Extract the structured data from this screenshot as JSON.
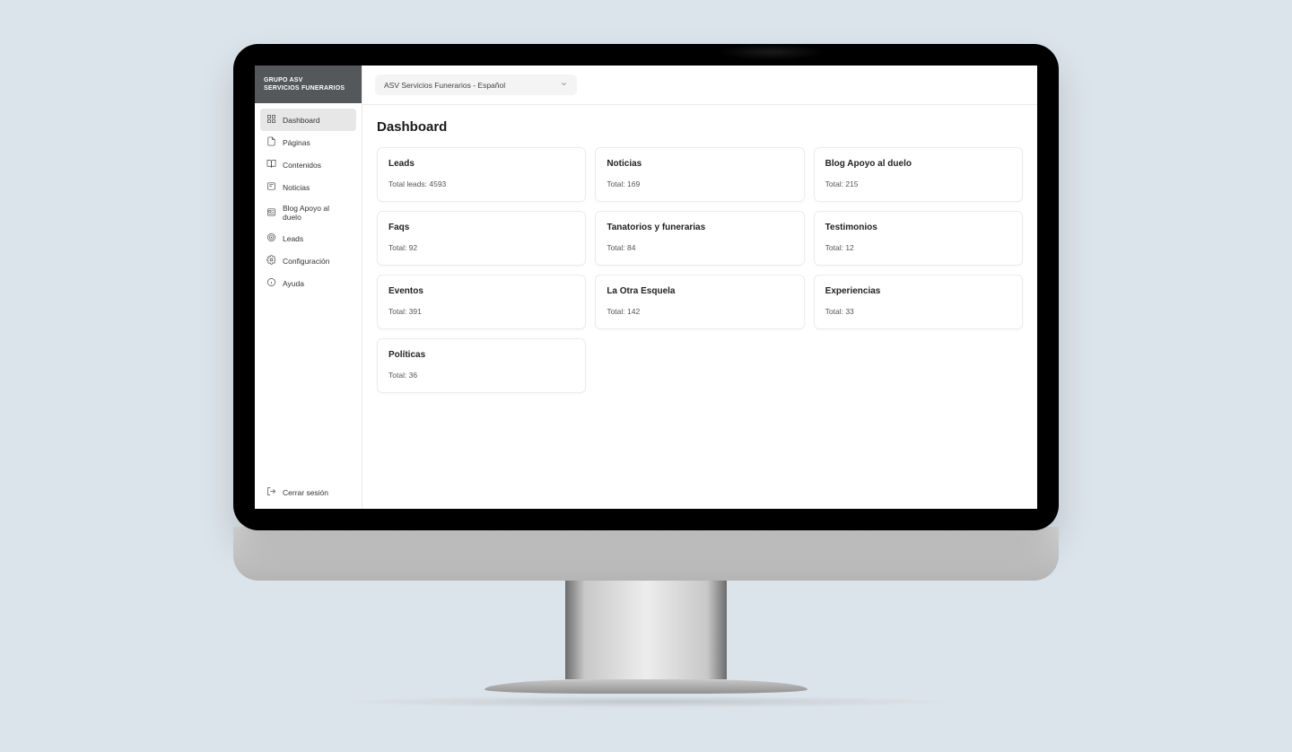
{
  "brand": {
    "line1": "GRUPO ASV",
    "line2": "SERVICIOS FUNERARIOS"
  },
  "topbar": {
    "siteSelector": "ASV Servicios Funerarios - Español"
  },
  "sidebar": {
    "items": [
      {
        "label": "Dashboard",
        "active": true
      },
      {
        "label": "Páginas"
      },
      {
        "label": "Contenidos"
      },
      {
        "label": "Noticias"
      },
      {
        "label": "Blog Apoyo al duelo"
      },
      {
        "label": "Leads"
      },
      {
        "label": "Configuración"
      },
      {
        "label": "Ayuda"
      }
    ],
    "logout": "Cerrar sesión"
  },
  "page": {
    "title": "Dashboard"
  },
  "cards": [
    {
      "title": "Leads",
      "stat": "Total leads: 4593"
    },
    {
      "title": "Noticias",
      "stat": "Total: 169"
    },
    {
      "title": "Blog Apoyo al duelo",
      "stat": "Total: 215"
    },
    {
      "title": "Faqs",
      "stat": "Total: 92"
    },
    {
      "title": "Tanatorios y funerarias",
      "stat": "Total: 84"
    },
    {
      "title": "Testimonios",
      "stat": "Total: 12"
    },
    {
      "title": "Eventos",
      "stat": "Total: 391"
    },
    {
      "title": "La Otra Esquela",
      "stat": "Total: 142"
    },
    {
      "title": "Experiencias",
      "stat": "Total: 33"
    },
    {
      "title": "Políticas",
      "stat": "Total: 36"
    }
  ]
}
